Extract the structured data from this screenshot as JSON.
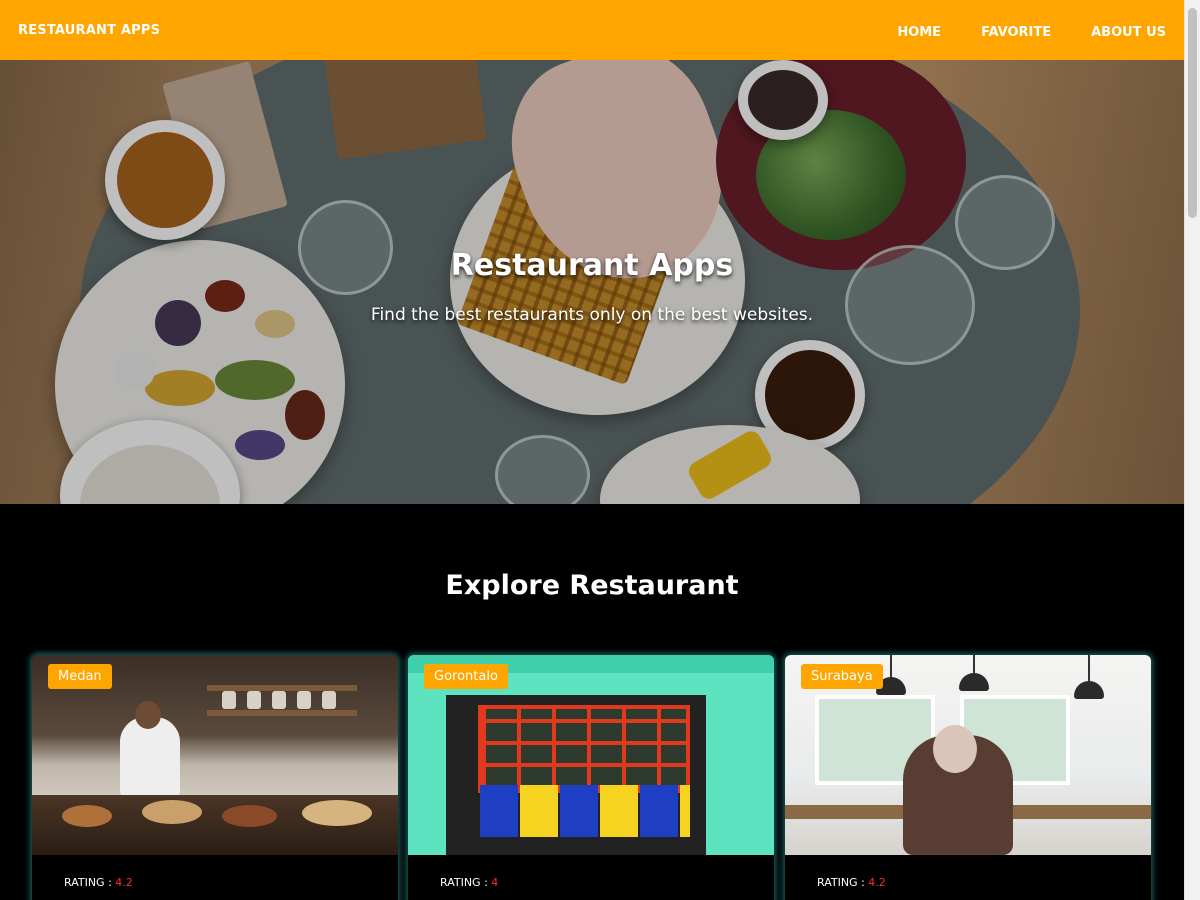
{
  "app_bar": {
    "brand": "RESTAURANT APPS",
    "nav": [
      {
        "label": "HOME"
      },
      {
        "label": "FAVORITE"
      },
      {
        "label": "ABOUT US"
      }
    ],
    "color": "#ffa500"
  },
  "hero": {
    "title": "Restaurant Apps",
    "subtitle": "Find the best restaurants only on the best websites."
  },
  "explore": {
    "title": "Explore Restaurant",
    "rating_label": "RATING :",
    "restaurants": [
      {
        "city": "Medan",
        "rating": "4.2"
      },
      {
        "city": "Gorontalo",
        "rating": "4"
      },
      {
        "city": "Surabaya",
        "rating": "4.2"
      }
    ]
  },
  "colors": {
    "accent": "#ffa500",
    "background": "#000000",
    "rating_value": "#ff2a2a",
    "card_glow": "#32aaaa"
  }
}
